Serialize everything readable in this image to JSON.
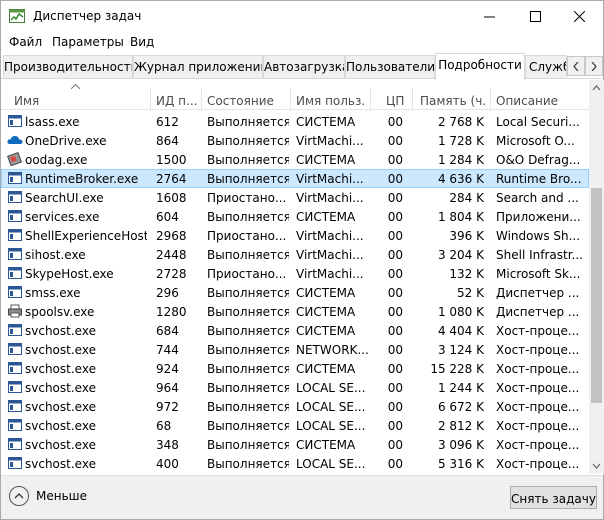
{
  "window": {
    "title": "Диспетчер задач"
  },
  "menu": [
    "Файл",
    "Параметры",
    "Вид"
  ],
  "tabs": [
    {
      "label": "Производительность",
      "active": false
    },
    {
      "label": "Журнал приложений",
      "active": false
    },
    {
      "label": "Автозагрузка",
      "active": false
    },
    {
      "label": "Пользователи",
      "active": false
    },
    {
      "label": "Подробности",
      "active": true
    },
    {
      "label": "Служб",
      "active": false
    }
  ],
  "columns": [
    "Имя",
    "ИД п...",
    "Состояние",
    "Имя польз...",
    "ЦП",
    "Память (ч...",
    "Описание"
  ],
  "sort": {
    "column": "Имя",
    "direction": "ascending"
  },
  "rows": [
    {
      "name": "lsass.exe",
      "pid": "612",
      "state": "Выполняется",
      "user": "СИСТЕМА",
      "cpu": "00",
      "mem": "2 768 K",
      "desc": "Local Securi...",
      "icon": "app-window-icon",
      "selected": false
    },
    {
      "name": "OneDrive.exe",
      "pid": "864",
      "state": "Выполняется",
      "user": "VirtMachi...",
      "cpu": "00",
      "mem": "1 728 K",
      "desc": "Microsoft O...",
      "icon": "onedrive-cloud-icon",
      "selected": false
    },
    {
      "name": "oodag.exe",
      "pid": "1500",
      "state": "Выполняется",
      "user": "СИСТЕМА",
      "cpu": "00",
      "mem": "1 284 K",
      "desc": "O&O Defrag...",
      "icon": "defrag-icon",
      "selected": false
    },
    {
      "name": "RuntimeBroker.exe",
      "pid": "2764",
      "state": "Выполняется",
      "user": "VirtMachi...",
      "cpu": "00",
      "mem": "4 636 K",
      "desc": "Runtime Bro...",
      "icon": "app-window-icon",
      "selected": true
    },
    {
      "name": "SearchUI.exe",
      "pid": "1608",
      "state": "Приостано...",
      "user": "VirtMachi...",
      "cpu": "00",
      "mem": "284 K",
      "desc": "Search and ...",
      "icon": "app-window-icon",
      "selected": false
    },
    {
      "name": "services.exe",
      "pid": "604",
      "state": "Выполняется",
      "user": "СИСТЕМА",
      "cpu": "00",
      "mem": "1 804 K",
      "desc": "Приложени...",
      "icon": "app-window-icon",
      "selected": false
    },
    {
      "name": "ShellExperienceHost....",
      "pid": "2968",
      "state": "Приостано...",
      "user": "VirtMachi...",
      "cpu": "00",
      "mem": "396 K",
      "desc": "Windows Sh...",
      "icon": "app-window-icon",
      "selected": false
    },
    {
      "name": "sihost.exe",
      "pid": "2448",
      "state": "Выполняется",
      "user": "VirtMachi...",
      "cpu": "00",
      "mem": "3 204 K",
      "desc": "Shell Infrastr...",
      "icon": "app-window-icon",
      "selected": false
    },
    {
      "name": "SkypeHost.exe",
      "pid": "2728",
      "state": "Приостано...",
      "user": "VirtMachi...",
      "cpu": "00",
      "mem": "132 K",
      "desc": "Microsoft Sk...",
      "icon": "app-window-icon",
      "selected": false
    },
    {
      "name": "smss.exe",
      "pid": "296",
      "state": "Выполняется",
      "user": "СИСТЕМА",
      "cpu": "00",
      "mem": "52 K",
      "desc": "Диспетчер ...",
      "icon": "app-window-icon",
      "selected": false
    },
    {
      "name": "spoolsv.exe",
      "pid": "1280",
      "state": "Выполняется",
      "user": "СИСТЕМА",
      "cpu": "00",
      "mem": "1 080 K",
      "desc": "Диспетчер ...",
      "icon": "printer-icon",
      "selected": false
    },
    {
      "name": "svchost.exe",
      "pid": "684",
      "state": "Выполняется",
      "user": "СИСТЕМА",
      "cpu": "00",
      "mem": "4 404 K",
      "desc": "Хост-проце...",
      "icon": "app-window-icon",
      "selected": false
    },
    {
      "name": "svchost.exe",
      "pid": "744",
      "state": "Выполняется",
      "user": "NETWORK...",
      "cpu": "00",
      "mem": "3 124 K",
      "desc": "Хост-проце...",
      "icon": "app-window-icon",
      "selected": false
    },
    {
      "name": "svchost.exe",
      "pid": "924",
      "state": "Выполняется",
      "user": "СИСТЕМА",
      "cpu": "00",
      "mem": "15 228 K",
      "desc": "Хост-проце...",
      "icon": "app-window-icon",
      "selected": false
    },
    {
      "name": "svchost.exe",
      "pid": "964",
      "state": "Выполняется",
      "user": "LOCAL SE...",
      "cpu": "00",
      "mem": "1 244 K",
      "desc": "Хост-проце...",
      "icon": "app-window-icon",
      "selected": false
    },
    {
      "name": "svchost.exe",
      "pid": "972",
      "state": "Выполняется",
      "user": "LOCAL SE...",
      "cpu": "00",
      "mem": "6 672 K",
      "desc": "Хост-проце...",
      "icon": "app-window-icon",
      "selected": false
    },
    {
      "name": "svchost.exe",
      "pid": "68",
      "state": "Выполняется",
      "user": "LOCAL SE...",
      "cpu": "00",
      "mem": "2 812 K",
      "desc": "Хост-проце...",
      "icon": "app-window-icon",
      "selected": false
    },
    {
      "name": "svchost.exe",
      "pid": "348",
      "state": "Выполняется",
      "user": "СИСТЕМА",
      "cpu": "00",
      "mem": "3 096 K",
      "desc": "Хост-проце...",
      "icon": "app-window-icon",
      "selected": false
    },
    {
      "name": "svchost.exe",
      "pid": "400",
      "state": "Выполняется",
      "user": "LOCAL SE...",
      "cpu": "00",
      "mem": "5 316 K",
      "desc": "Хост-проце...",
      "icon": "app-window-icon",
      "selected": false
    }
  ],
  "footer": {
    "less_label": "Меньше",
    "end_task_label": "Снять задачу"
  },
  "colors": {
    "selection_bg": "#cce8ff",
    "selection_border": "#99d1ff",
    "onedrive_blue": "#0f6cc0"
  }
}
